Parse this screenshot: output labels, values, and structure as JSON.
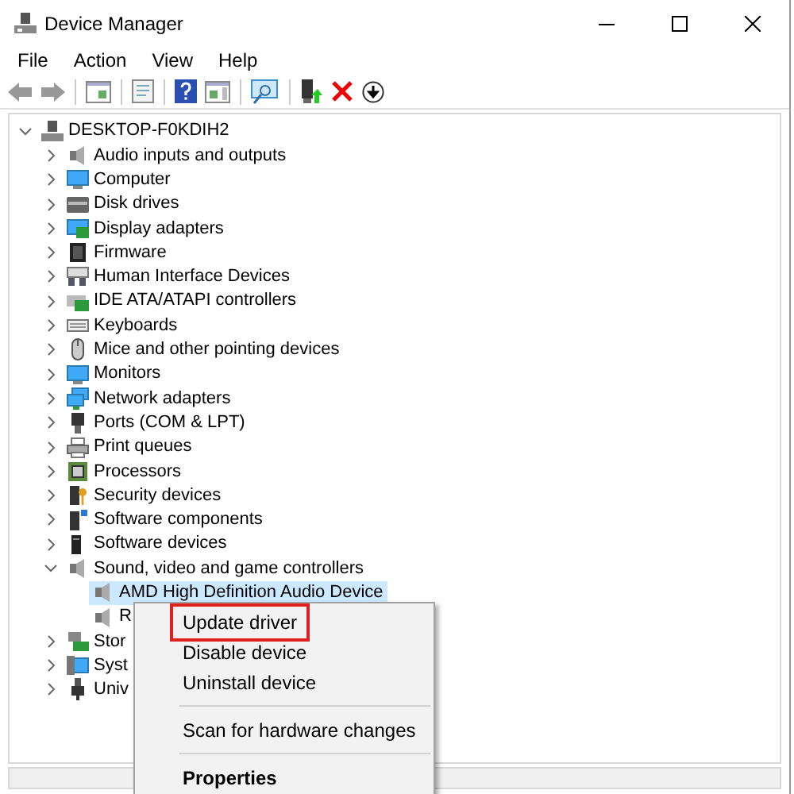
{
  "window": {
    "title": "Device Manager"
  },
  "menu": [
    "File",
    "Action",
    "View",
    "Help"
  ],
  "tree": {
    "label": "DESKTOP-F0KDIH2",
    "expanded": true,
    "children": [
      {
        "label": "Audio inputs and outputs",
        "expanded": false
      },
      {
        "label": "Computer",
        "expanded": false
      },
      {
        "label": "Disk drives",
        "expanded": false
      },
      {
        "label": "Display adapters",
        "expanded": false
      },
      {
        "label": "Firmware",
        "expanded": false
      },
      {
        "label": "Human Interface Devices",
        "expanded": false
      },
      {
        "label": "IDE ATA/ATAPI controllers",
        "expanded": false
      },
      {
        "label": "Keyboards",
        "expanded": false
      },
      {
        "label": "Mice and other pointing devices",
        "expanded": false
      },
      {
        "label": "Monitors",
        "expanded": false
      },
      {
        "label": "Network adapters",
        "expanded": false
      },
      {
        "label": "Ports (COM & LPT)",
        "expanded": false
      },
      {
        "label": "Print queues",
        "expanded": false
      },
      {
        "label": "Processors",
        "expanded": false
      },
      {
        "label": "Security devices",
        "expanded": false
      },
      {
        "label": "Software components",
        "expanded": false
      },
      {
        "label": "Software devices",
        "expanded": false
      },
      {
        "label": "Sound, video and game controllers",
        "expanded": true,
        "children": [
          {
            "label": "AMD High Definition Audio Device",
            "selected": true
          },
          {
            "label": "R",
            "selected": false
          }
        ]
      },
      {
        "label": "Stor",
        "expanded": false
      },
      {
        "label": "Syst",
        "expanded": false
      },
      {
        "label": "Univ",
        "expanded": false
      }
    ]
  },
  "context_menu": [
    {
      "kind": "item",
      "label": "Update driver",
      "highlighted": true
    },
    {
      "kind": "item",
      "label": "Disable device",
      "highlighted": false
    },
    {
      "kind": "item",
      "label": "Uninstall device",
      "highlighted": false
    },
    {
      "kind": "separator"
    },
    {
      "kind": "item",
      "label": "Scan for hardware changes",
      "highlighted": false
    },
    {
      "kind": "separator"
    },
    {
      "kind": "default",
      "label": "Properties",
      "highlighted": false
    }
  ]
}
